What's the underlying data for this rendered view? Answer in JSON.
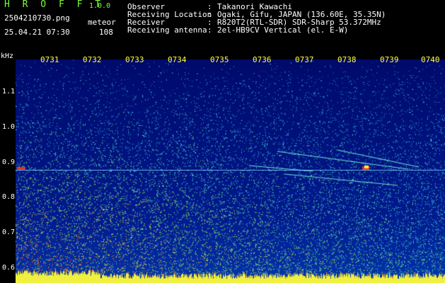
{
  "header": {
    "app_title": "H R O F F T",
    "app_version": "1.0.0",
    "filename": "2504210730.png",
    "event_type": "meteor",
    "datetime": "25.04.21 07:30",
    "count": "108"
  },
  "info": [
    {
      "key": "Observer",
      "value": "Takanori Kawachi"
    },
    {
      "key": "Receiving Location",
      "value": "Ogaki, Gifu, JAPAN (136.60E, 35.35N)"
    },
    {
      "key": "Receiver",
      "value": "R820T2(RTL-SDR) SDR-Sharp 53.372MHz"
    },
    {
      "key": "Receiving antenna",
      "value": "2el-HB9CV Vertical (el. E-W)"
    }
  ],
  "axes": {
    "freq_unit": "kHz",
    "time_labels": [
      "0731",
      "0732",
      "0733",
      "0734",
      "0735",
      "0736",
      "0737",
      "0738",
      "0739",
      "0740"
    ],
    "freq_labels": [
      "1.1",
      "1.0",
      "0.9",
      "0.8",
      "0.7",
      "0.6"
    ]
  },
  "colors": {
    "accent_green": "#7dff3a",
    "axis_yellow": "#ffff40",
    "signal_cyan": "#7fd4ff"
  }
}
